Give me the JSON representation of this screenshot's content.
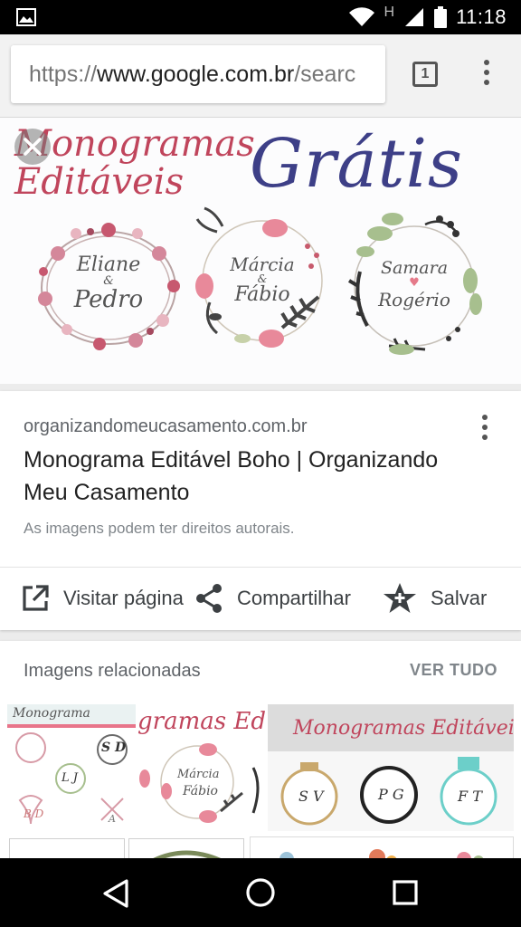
{
  "status_bar": {
    "time": "11:18",
    "network_glyph": "H",
    "icons": [
      "image-notification-icon",
      "wifi-icon",
      "signal-icon",
      "battery-icon"
    ]
  },
  "browser": {
    "url_scheme": "https://",
    "url_host": "www.google.com.br",
    "url_rest": "/searc",
    "tab_count": "1"
  },
  "hero": {
    "title_a": [
      "Monogramas",
      "Editáveis"
    ],
    "title_b": "Grátis",
    "wreaths": [
      {
        "name_1": "Eliane",
        "amp": "&",
        "name_2": "Pedro"
      },
      {
        "name_1": "Márcia",
        "amp": "&",
        "name_2": "Fábio"
      },
      {
        "name_1": "Samara",
        "amp": "♥",
        "name_2": "Rogério"
      }
    ]
  },
  "result": {
    "domain": "organizandomeucasamento.com.br",
    "title": "Monograma Editável Boho | Organizando Meu Casamento",
    "copyright_notice": "As imagens podem ter direitos autorais.",
    "actions": {
      "visit": "Visitar página",
      "share": "Compartilhar",
      "save": "Salvar"
    }
  },
  "related": {
    "label": "Imagens relacionadas",
    "see_all": "VER TUDO",
    "thumbs": [
      {
        "caption": "Monograma",
        "monograms": [
          "S D",
          "L J",
          "B D",
          "A"
        ]
      },
      {
        "caption": "gramas Edi",
        "monograms": [
          "Márcia",
          "Fábio"
        ]
      },
      {
        "caption": "Monogramas Editáveis",
        "monograms": [
          "S V",
          "P G",
          "F T"
        ]
      }
    ]
  },
  "colors": {
    "accent_pink": "#c0455c",
    "accent_navy": "#3d3f87",
    "sage_green": "#a7bf8e",
    "text_primary": "#212121",
    "text_secondary": "#5f6368"
  }
}
